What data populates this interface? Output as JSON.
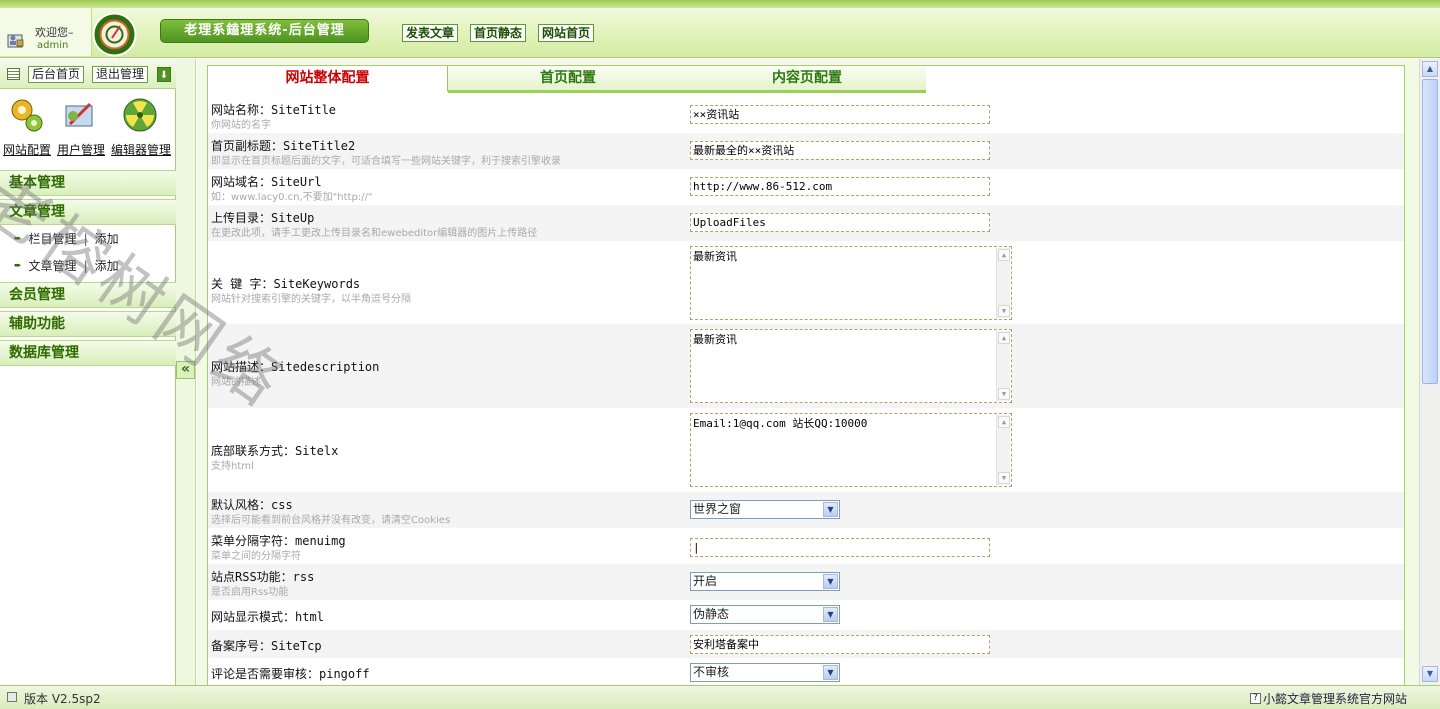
{
  "header": {
    "welcome": "欢迎您–",
    "username": "admin",
    "system_title": "老理系鎑理系统-后台管理",
    "links": [
      "发表文章",
      "首页静态",
      "网站首页"
    ]
  },
  "sidebar": {
    "toolbar": {
      "home": "后台首页",
      "logout": "退出管理"
    },
    "quick_labels": [
      "网站配置",
      "用户管理",
      "编辑器管理"
    ],
    "menus": {
      "basic": "基本管理",
      "article": "文章管理",
      "column_mgmt": "栏目管理",
      "column_add": "添加",
      "article_mgmt": "文章管理",
      "article_add": "添加",
      "member": "会员管理",
      "aux": "辅助功能",
      "db": "数据库管理"
    }
  },
  "tabs": [
    "网站整体配置",
    "首页配置",
    "内容页配置"
  ],
  "form": {
    "site_title": {
      "label": "网站名称：SiteTitle",
      "hint": "你网站的名字",
      "value": "××资讯站"
    },
    "site_title2": {
      "label": "首页副标题：SiteTitle2",
      "hint": "即显示在首页标题后面的文字，可适合填写一些网站关键字，利于搜索引擎收录",
      "value": "最新最全的××资讯站"
    },
    "site_url": {
      "label": "网站域名：SiteUrl",
      "hint": "如：www.lacy0.cn,不要加\"http://\"",
      "value": "http://www.86-512.com"
    },
    "site_up": {
      "label": "上传目录：SiteUp",
      "hint": "在更改此项，请手工更改上传目录名和ewebeditor编辑器的图片上传路径",
      "value": "UploadFiles"
    },
    "keywords": {
      "label": "关 键 字：SiteKeywords",
      "hint": "网站针对搜索引擎的关键字，以半角逗号分隔",
      "value": "最新资讯"
    },
    "description": {
      "label": "网站描述：Sitedescription",
      "hint": "网站的描述",
      "value": "最新资讯"
    },
    "sitelx": {
      "label": "底部联系方式：Sitelx",
      "hint": "支持html",
      "value": "Email:1@qq.com 站长QQ:10000"
    },
    "css": {
      "label": "默认风格：css",
      "hint": "选择后可能看到前台风格并没有改变，请清空Cookies",
      "value": "世界之窗"
    },
    "menuimg": {
      "label": "菜单分隔字符：menuimg",
      "hint": "菜单之间的分隔字符",
      "value": "|"
    },
    "rss": {
      "label": "站点RSS功能：rss",
      "hint": "是否启用Rss功能",
      "value": "开启"
    },
    "html": {
      "label": "网站显示模式：html",
      "value": "伪静态"
    },
    "sitetcp": {
      "label": "备案序号：SiteTcp",
      "value": "安利塔备案中"
    },
    "pingoff": {
      "label": "评论是否需要审核：pingoff",
      "value": "不审核"
    }
  },
  "footer": {
    "version": "版本 V2.5sp2",
    "official_link": "小懿文章管理系统官方网站"
  },
  "watermark": "老榕树网络"
}
